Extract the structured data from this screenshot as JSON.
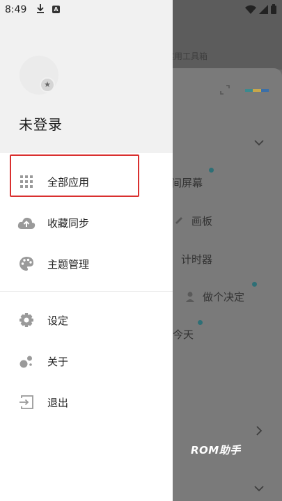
{
  "status_bar": {
    "time": "8:49",
    "download_icon": "download-icon",
    "notification_icon": "a-app-icon",
    "wifi_icon": "wifi-icon",
    "signal_icon": "signal-icon",
    "battery_icon": "battery-icon"
  },
  "drawer": {
    "avatar_badge_icon": "star-icon",
    "login_status": "未登录",
    "menu_primary": [
      {
        "label": "全部应用",
        "icon": "grid-icon"
      },
      {
        "label": "收藏同步",
        "icon": "cloud-upload-icon"
      },
      {
        "label": "主题管理",
        "icon": "palette-icon"
      }
    ],
    "menu_secondary": [
      {
        "label": "设定",
        "icon": "gear-icon"
      },
      {
        "label": "关于",
        "icon": "bubbles-icon"
      },
      {
        "label": "退出",
        "icon": "exit-icon"
      }
    ],
    "highlight_color": "#d9302f"
  },
  "background_app": {
    "subtitle": "实用工具箱",
    "tools": [
      "间屏幕",
      "画板",
      "计时器",
      "做个决定",
      "今天"
    ],
    "dot_color": "#2e6f76",
    "color_bar": [
      "#3b8a8f",
      "#c7a64a",
      "#3b6fa8"
    ]
  },
  "watermark": "ROM助手"
}
